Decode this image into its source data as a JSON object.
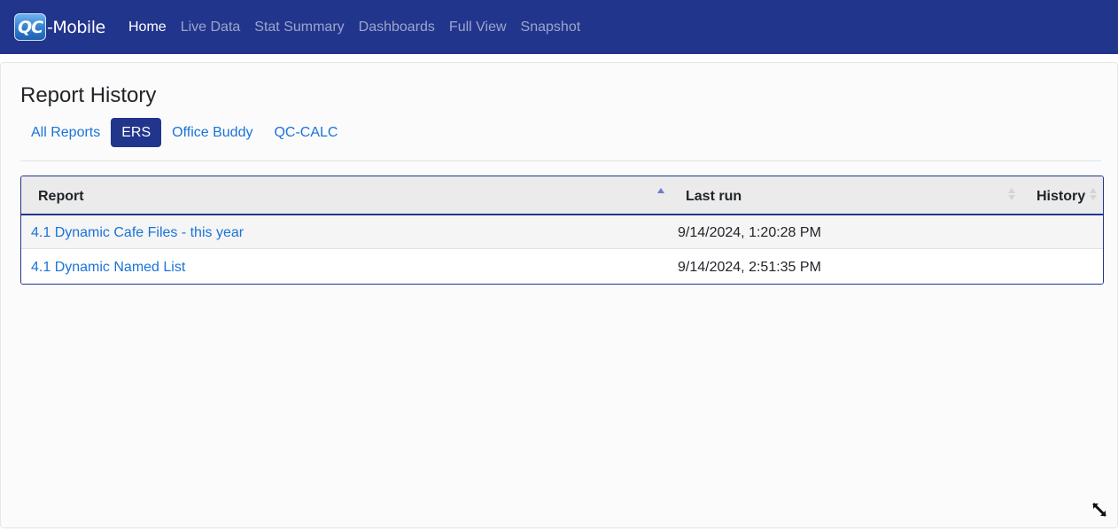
{
  "app": {
    "logo_badge": "QC",
    "logo_text": "-Mobile"
  },
  "nav": {
    "items": [
      {
        "label": "Home",
        "active": true
      },
      {
        "label": "Live Data",
        "active": false
      },
      {
        "label": "Stat Summary",
        "active": false
      },
      {
        "label": "Dashboards",
        "active": false
      },
      {
        "label": "Full View",
        "active": false
      },
      {
        "label": "Snapshot",
        "active": false
      }
    ]
  },
  "page": {
    "title": "Report History"
  },
  "tabs": [
    {
      "label": "All Reports",
      "active": false
    },
    {
      "label": "ERS",
      "active": true
    },
    {
      "label": "Office Buddy",
      "active": false
    },
    {
      "label": "QC-CALC",
      "active": false
    }
  ],
  "table": {
    "columns": [
      {
        "label": "Report",
        "sort": "ascending"
      },
      {
        "label": "Last run",
        "sort": "none"
      },
      {
        "label": "History",
        "sort": "none"
      }
    ],
    "rows": [
      {
        "report": "4.1 Dynamic Cafe Files - this year",
        "last_run": "9/14/2024, 1:20:28 PM",
        "history": ""
      },
      {
        "report": "4.1 Dynamic Named List",
        "last_run": "9/14/2024, 2:51:35 PM",
        "history": ""
      }
    ]
  },
  "colors": {
    "brand_navy": "#22358c",
    "link_blue": "#1a73d9",
    "sort_active": "#6a7bd1"
  }
}
